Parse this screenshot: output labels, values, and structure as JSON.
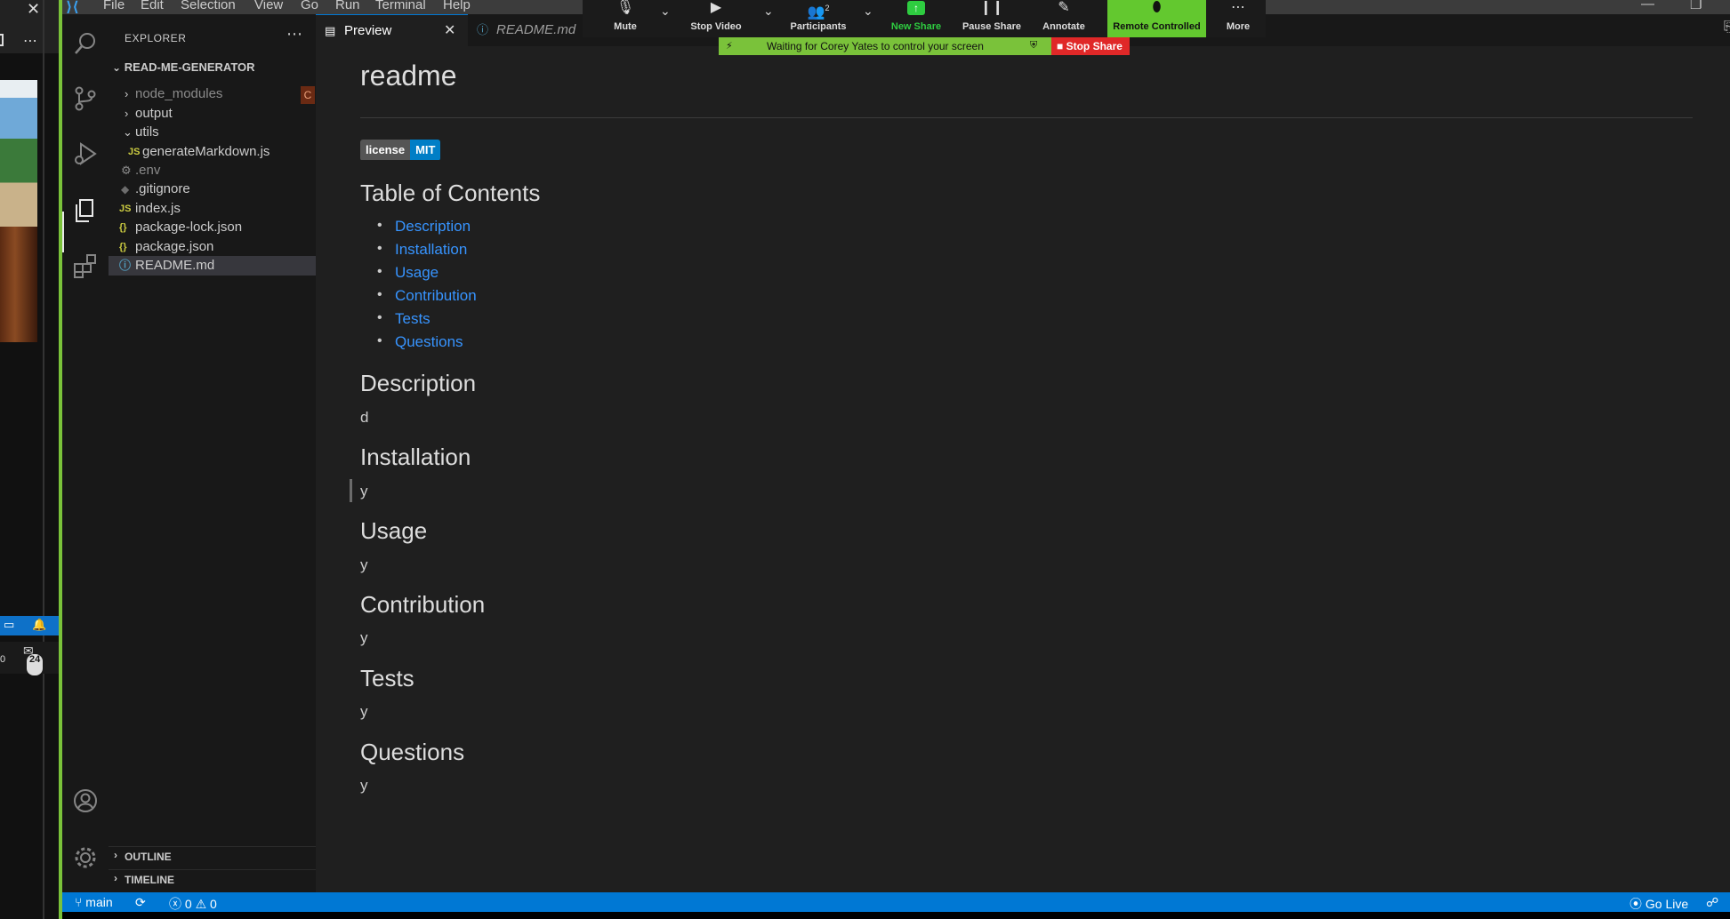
{
  "window": {
    "controls": [
      "—",
      "❐"
    ]
  },
  "menu": [
    "File",
    "Edit",
    "Selection",
    "View",
    "Go",
    "Run",
    "Terminal",
    "Help"
  ],
  "left_panel": {
    "close_glyph": "✕",
    "more_glyph": "⋯",
    "chat_count": "24",
    "side_number": "0"
  },
  "zoom": {
    "mute": "Mute",
    "stop_video": "Stop Video",
    "participants": "Participants",
    "participants_count": "2",
    "new_share": "New Share",
    "pause_share": "Pause Share",
    "annotate": "Annotate",
    "remote_controlled": "Remote Controlled",
    "more": "More",
    "waiting_text": "Waiting for Corey Yates to control your screen",
    "stop_share": "Stop Share"
  },
  "explorer": {
    "title": "EXPLORER",
    "root": "READ-ME-GENERATOR",
    "items": [
      {
        "name": "node_modules",
        "icon": ""
      },
      {
        "name": "output",
        "icon": ""
      },
      {
        "name": "utils",
        "icon": ""
      },
      {
        "name": "generateMarkdown.js",
        "icon": "JS"
      },
      {
        "name": ".env",
        "icon": "⚙"
      },
      {
        "name": ".gitignore",
        "icon": "◆"
      },
      {
        "name": "index.js",
        "icon": "JS"
      },
      {
        "name": "package-lock.json",
        "icon": "{}"
      },
      {
        "name": "package.json",
        "icon": "{}"
      },
      {
        "name": "README.md",
        "icon": "ⓘ"
      }
    ],
    "node_modules_badge": "C",
    "outline": "OUTLINE",
    "timeline": "TIMELINE"
  },
  "tabs": [
    {
      "label": "Preview README.md",
      "active": true
    },
    {
      "label": "README.md",
      "active": false
    }
  ],
  "preview": {
    "title": "readme",
    "badge_left": "license",
    "badge_right": "MIT",
    "toc_heading": "Table of Contents",
    "toc": [
      "Description",
      "Installation",
      "Usage",
      "Contribution",
      "Tests",
      "Questions"
    ],
    "sections": [
      {
        "heading": "Description",
        "body": "d"
      },
      {
        "heading": "Installation",
        "body": "y"
      },
      {
        "heading": "Usage",
        "body": "y"
      },
      {
        "heading": "Contribution",
        "body": "y"
      },
      {
        "heading": "Tests",
        "body": "y"
      },
      {
        "heading": "Questions",
        "body": "y"
      }
    ]
  },
  "status": {
    "branch": "main",
    "errors": "0",
    "warnings": "0",
    "go_live": "Go Live"
  },
  "colors": {
    "accent": "#0078d4",
    "link": "#3794ff",
    "zoom_green": "#7ac23a",
    "stop_red": "#e02828"
  }
}
